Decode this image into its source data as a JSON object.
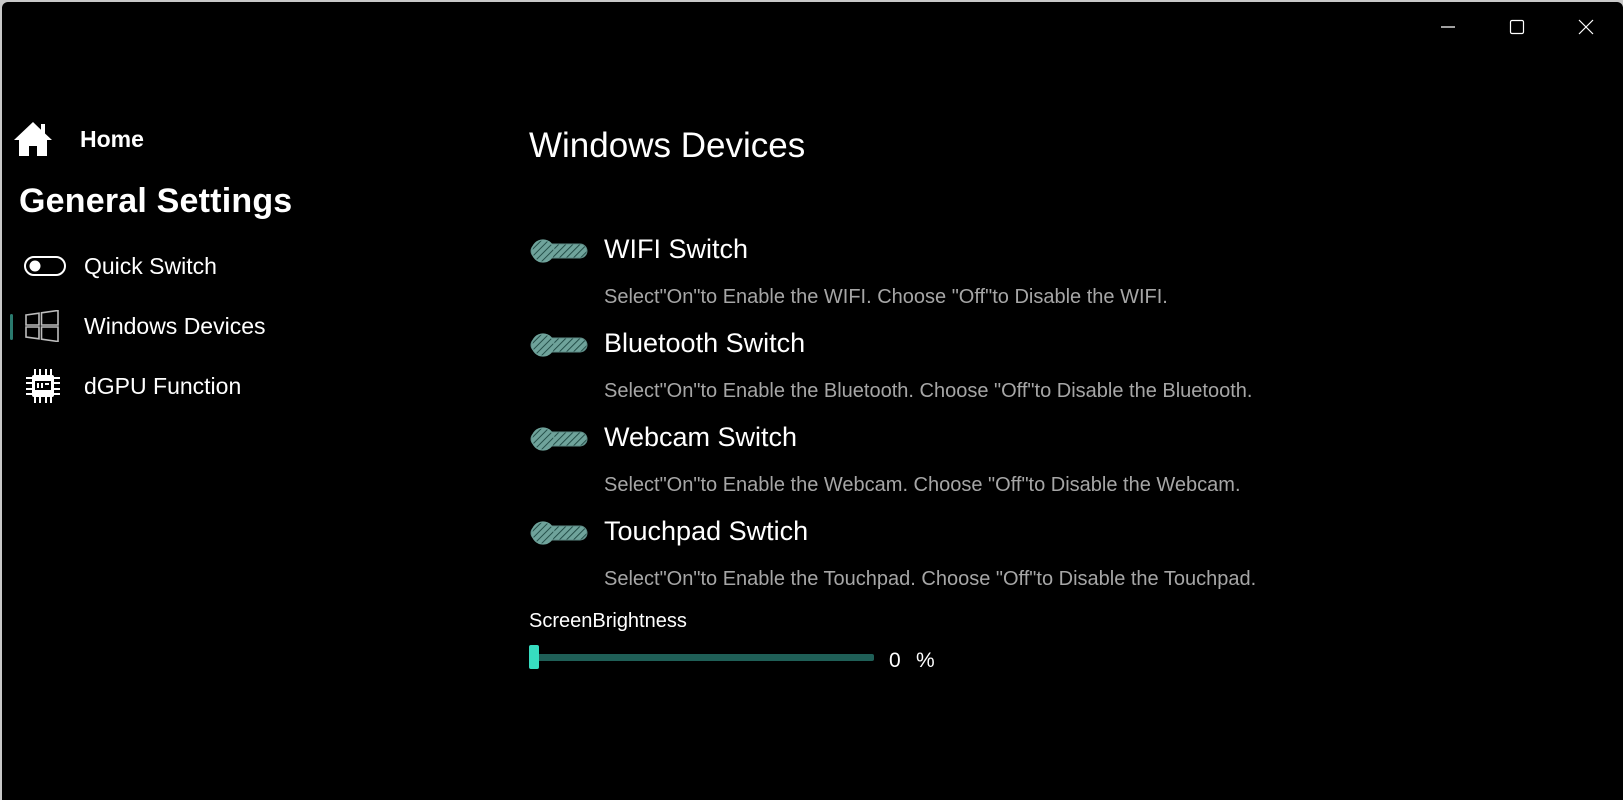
{
  "window": {
    "controls": [
      "minimize-icon",
      "maximize-icon",
      "close-icon"
    ]
  },
  "sidebar": {
    "home_label": "Home",
    "heading": "General Settings",
    "items": [
      {
        "label": "Quick Switch",
        "icon": "toggle-icon",
        "selected": false
      },
      {
        "label": "Windows Devices",
        "icon": "windows-logo-icon",
        "selected": true
      },
      {
        "label": "dGPU Function",
        "icon": "gpu-chip-icon",
        "selected": false
      }
    ],
    "accent_color": "#2a7a6e"
  },
  "main": {
    "title": "Windows Devices",
    "settings": [
      {
        "title": "WIFI Switch",
        "description": "Select\"On\"to Enable the WIFI. Choose \"Off\"to Disable the WIFI.",
        "state": "off"
      },
      {
        "title": "Bluetooth Switch",
        "description": "Select\"On\"to Enable the Bluetooth. Choose \"Off\"to Disable the Bluetooth.",
        "state": "off"
      },
      {
        "title": "Webcam Switch",
        "description": "Select\"On\"to Enable the Webcam. Choose \"Off\"to Disable the Webcam.",
        "state": "off"
      },
      {
        "title": "Touchpad Swtich",
        "description": "Select\"On\"to Enable the Touchpad. Choose \"Off\"to Disable the Touchpad.",
        "state": "off"
      }
    ],
    "brightness": {
      "label": "ScreenBrightness",
      "value": "0",
      "unit": "%",
      "level_percent": 0,
      "accent_color": "#37dcc0"
    }
  }
}
